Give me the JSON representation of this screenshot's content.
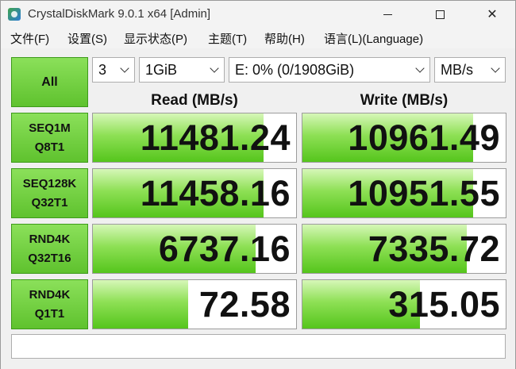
{
  "window": {
    "title": "CrystalDiskMark 9.0.1 x64 [Admin]"
  },
  "menu": [
    "文件(F)",
    "设置(S)",
    "显示状态(P)",
    "主题(T)",
    "帮助(H)",
    "语言(L)(Language)"
  ],
  "controls": {
    "all_label": "All",
    "count": "3",
    "size": "1GiB",
    "drive": "E: 0% (0/1908GiB)",
    "unit": "MB/s"
  },
  "headers": {
    "read": "Read (MB/s)",
    "write": "Write (MB/s)"
  },
  "tests": [
    {
      "line1": "SEQ1M",
      "line2": "Q8T1",
      "read": "11481.24",
      "write": "10961.49",
      "read_fill": 0.84,
      "write_fill": 0.84
    },
    {
      "line1": "SEQ128K",
      "line2": "Q32T1",
      "read": "11458.16",
      "write": "10951.55",
      "read_fill": 0.84,
      "write_fill": 0.84
    },
    {
      "line1": "RND4K",
      "line2": "Q32T16",
      "read": "6737.16",
      "write": "7335.72",
      "read_fill": 0.8,
      "write_fill": 0.81
    },
    {
      "line1": "RND4K",
      "line2": "Q1T1",
      "read": "72.58",
      "write": "315.05",
      "read_fill": 0.47,
      "write_fill": 0.58
    }
  ],
  "status": {
    "comment": ""
  },
  "colors": {
    "accent_green": "#5fc22e",
    "fill_light": "#d6f7b8"
  }
}
